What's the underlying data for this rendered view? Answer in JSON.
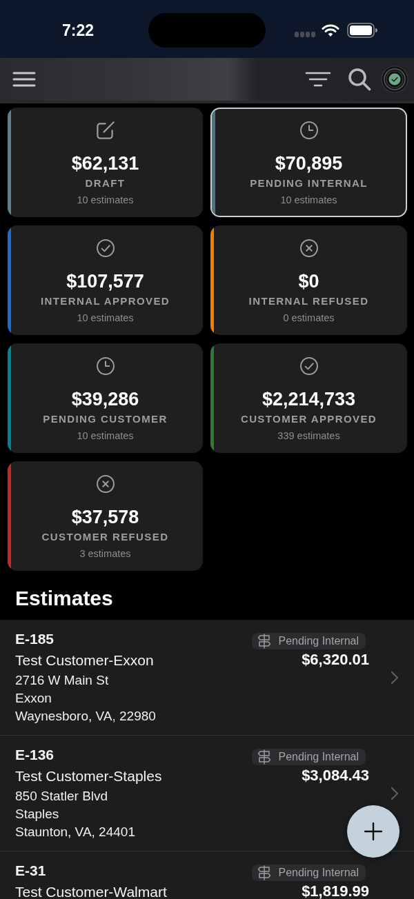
{
  "status_bar": {
    "time": "7:22"
  },
  "summary_cards": [
    {
      "kind": "draft",
      "amount": "$62,131",
      "label": "DRAFT",
      "count": "10 estimates",
      "color": "#627f8d",
      "selected": false
    },
    {
      "kind": "pending",
      "amount": "$70,895",
      "label": "PENDING INTERNAL",
      "count": "10 estimates",
      "color": "#56707d",
      "selected": true
    },
    {
      "kind": "approved",
      "amount": "$107,577",
      "label": "INTERNAL APPROVED",
      "count": "10 estimates",
      "color": "#1b6ccf",
      "selected": false
    },
    {
      "kind": "refused",
      "amount": "$0",
      "label": "INTERNAL REFUSED",
      "count": "0 estimates",
      "color": "#f57c00",
      "selected": false
    },
    {
      "kind": "pending",
      "amount": "$39,286",
      "label": "PENDING CUSTOMER",
      "count": "10 estimates",
      "color": "#00838f",
      "selected": false
    },
    {
      "kind": "approved",
      "amount": "$2,214,733",
      "label": "CUSTOMER APPROVED",
      "count": "339 estimates",
      "color": "#2e7d32",
      "selected": false
    },
    {
      "kind": "refused",
      "amount": "$37,578",
      "label": "CUSTOMER REFUSED",
      "count": "3 estimates",
      "color": "#c62828",
      "selected": false
    }
  ],
  "section_title": "Estimates",
  "estimates": [
    {
      "number": "E-185",
      "customer": "Test Customer-Exxon",
      "address_lines": [
        "2716 W Main St",
        "Exxon",
        "Waynesboro, VA, 22980"
      ],
      "status": "Pending Internal",
      "amount": "$6,320.01"
    },
    {
      "number": "E-136",
      "customer": "Test Customer-Staples",
      "address_lines": [
        "850 Statler Blvd",
        "Staples",
        "Staunton, VA, 24401"
      ],
      "status": "Pending Internal",
      "amount": "$3,084.43"
    },
    {
      "number": "E-31",
      "customer": "Test Customer-Walmart",
      "status": "Pending Internal",
      "amount": "$1,819.99"
    }
  ]
}
